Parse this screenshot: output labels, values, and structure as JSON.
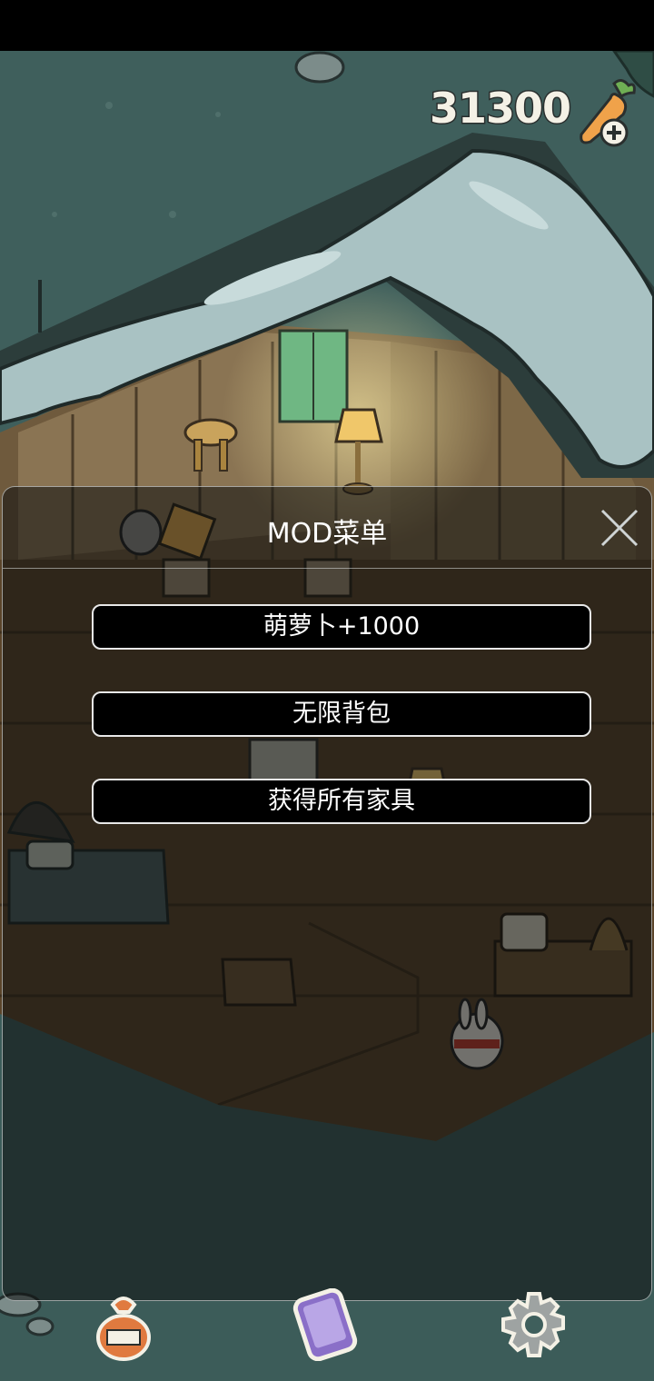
{
  "currency": {
    "amount": "31300",
    "icon": "carrot-add-icon"
  },
  "menu": {
    "title": "MOD菜单",
    "close_icon": "close-icon",
    "buttons": [
      {
        "label": "萌萝卜+1000"
      },
      {
        "label": "无限背包"
      },
      {
        "label": "获得所有家具"
      }
    ]
  },
  "bottom_bar": {
    "items": [
      {
        "icon": "bag-icon"
      },
      {
        "icon": "phone-icon"
      },
      {
        "icon": "gear-icon"
      }
    ]
  },
  "colors": {
    "background": "#3f5f5c",
    "overlay": "#0c0e0e",
    "button_bg": "#000000",
    "button_border": "#e8e8e8",
    "carrot": "#f0a24a"
  }
}
